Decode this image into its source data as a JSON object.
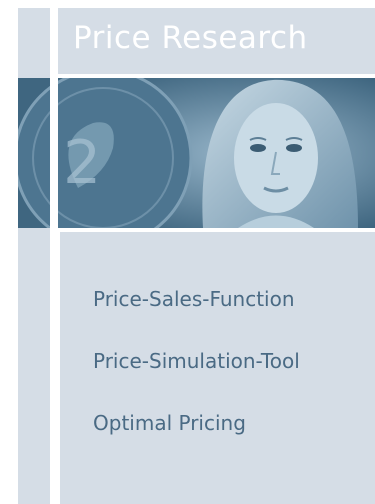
{
  "header": {
    "title": "Price Research"
  },
  "hero": {
    "image_subjects": [
      "euro-coin-icon",
      "woman-portrait"
    ]
  },
  "menu": {
    "items": [
      {
        "label": "Price-Sales-Function"
      },
      {
        "label": "Price-Simulation-Tool"
      },
      {
        "label": "Optimal Pricing"
      }
    ]
  },
  "colors": {
    "panel": "#d5dde6",
    "photo_tint": "#567b95",
    "menu_text": "#4a6a84",
    "title_text": "#ffffff"
  }
}
